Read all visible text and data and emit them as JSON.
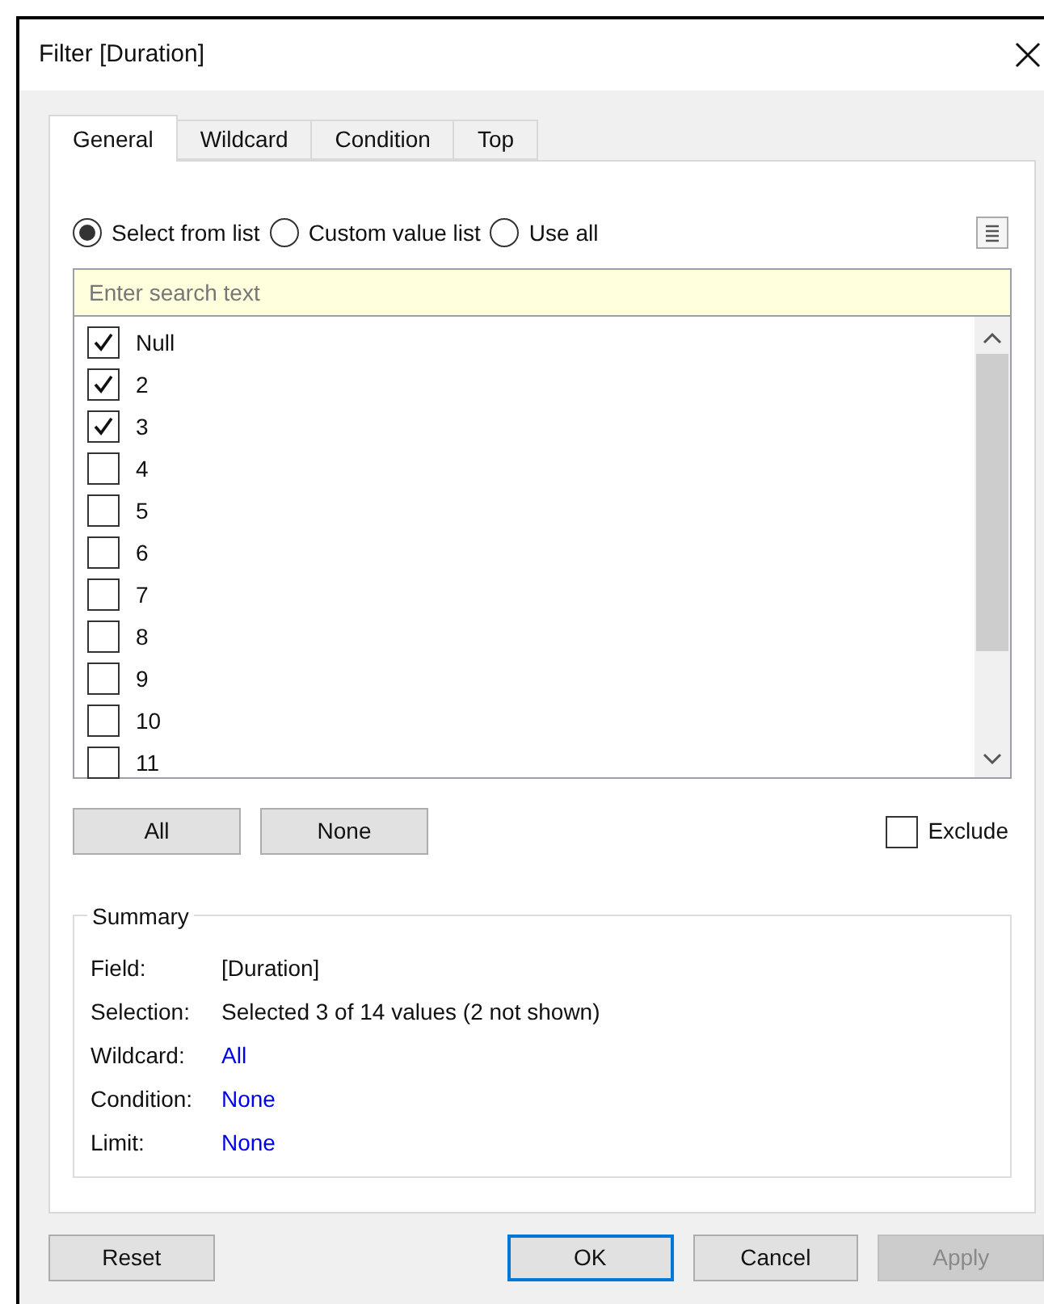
{
  "window": {
    "title": "Filter [Duration]"
  },
  "tabs": [
    {
      "label": "General",
      "selected": true
    },
    {
      "label": "Wildcard",
      "selected": false
    },
    {
      "label": "Condition",
      "selected": false
    },
    {
      "label": "Top",
      "selected": false
    }
  ],
  "modes": [
    {
      "label": "Select from list",
      "selected": true
    },
    {
      "label": "Custom value list",
      "selected": false
    },
    {
      "label": "Use all",
      "selected": false
    }
  ],
  "search": {
    "placeholder": "Enter search text"
  },
  "values": [
    {
      "label": "Null",
      "checked": true
    },
    {
      "label": "2",
      "checked": true
    },
    {
      "label": "3",
      "checked": true
    },
    {
      "label": "4",
      "checked": false
    },
    {
      "label": "5",
      "checked": false
    },
    {
      "label": "6",
      "checked": false
    },
    {
      "label": "7",
      "checked": false
    },
    {
      "label": "8",
      "checked": false
    },
    {
      "label": "9",
      "checked": false
    },
    {
      "label": "10",
      "checked": false
    },
    {
      "label": "11",
      "checked": false
    }
  ],
  "list_buttons": [
    "All",
    "None"
  ],
  "exclude": {
    "label": "Exclude",
    "checked": false
  },
  "summary": {
    "title": "Summary",
    "rows": [
      {
        "label": "Field:",
        "value": "[Duration]",
        "kind": "plain"
      },
      {
        "label": "Selection:",
        "value": "Selected 3 of 14 values (2 not shown)",
        "kind": "plain"
      },
      {
        "label": "Wildcard:",
        "value": "All",
        "kind": "link"
      },
      {
        "label": "Condition:",
        "value": "None",
        "kind": "link"
      },
      {
        "label": "Limit:",
        "value": "None",
        "kind": "link"
      }
    ]
  },
  "buttons": [
    {
      "label": "Reset",
      "kind": "normal",
      "disabled": false
    },
    {
      "label": "OK",
      "kind": "default",
      "disabled": false
    },
    {
      "label": "Cancel",
      "kind": "normal",
      "disabled": false
    },
    {
      "label": "Apply",
      "kind": "normal",
      "disabled": true
    }
  ]
}
